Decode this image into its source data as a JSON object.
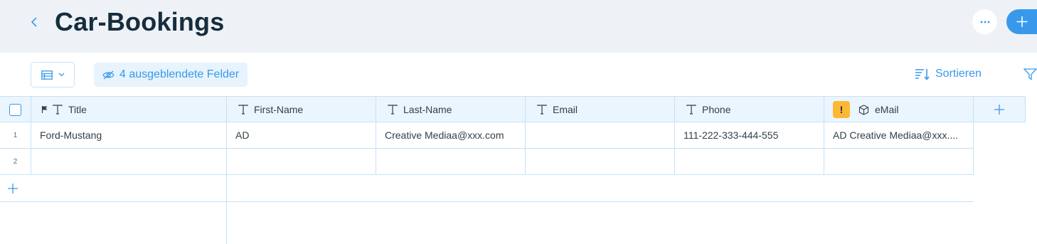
{
  "header": {
    "title": "Car-Bookings",
    "back_icon": "chevron-left-icon",
    "more_icon": "more-icon",
    "add_icon": "plus-icon"
  },
  "toolbar": {
    "view_icon": "table-view-icon",
    "hidden_fields_label": "4 ausgeblendete Felder",
    "sort_label": "Sortieren",
    "filter_icon": "filter-icon"
  },
  "table": {
    "columns": [
      {
        "label": "Title",
        "icon": "text-type-icon",
        "primary": true
      },
      {
        "label": "First-Name",
        "icon": "text-type-icon"
      },
      {
        "label": "Last-Name",
        "icon": "text-type-icon"
      },
      {
        "label": "Email",
        "icon": "text-type-icon"
      },
      {
        "label": "Phone",
        "icon": "text-type-icon"
      },
      {
        "label": "eMail",
        "icon": "cube-icon",
        "warning": "!"
      }
    ],
    "rows": [
      {
        "num": "1",
        "cells": [
          "Ford-Mustang",
          "AD",
          "Creative Mediaa@xxx.com",
          "",
          "111-222-333-444-555",
          "AD Creative Mediaa@xxx...."
        ]
      },
      {
        "num": "2",
        "cells": [
          "",
          "",
          "",
          "",
          "",
          ""
        ]
      }
    ]
  },
  "colors": {
    "accent": "#3899ec",
    "header_bg": "#eef2f6",
    "table_header_bg": "#eaf5fe",
    "warning": "#fdb833",
    "title": "#162d3d"
  }
}
